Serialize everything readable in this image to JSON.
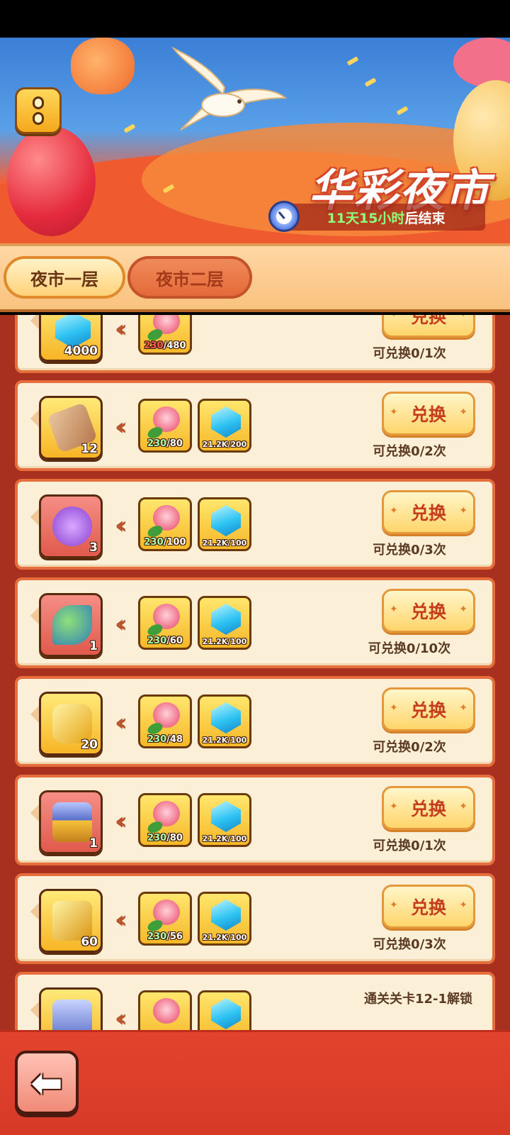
{
  "event": {
    "title": "华彩夜市",
    "timer_prefix": "11天15小时",
    "timer_suffix": "后结束"
  },
  "tabs": [
    {
      "label": "夜市一层",
      "active": true
    },
    {
      "label": "夜市二层",
      "active": false
    }
  ],
  "exchange_label": "兑换",
  "items": [
    {
      "reward_icon": "gem-icon",
      "reward_qty": "4000",
      "slot_color": "gold",
      "flower_have": "230",
      "flower_need": "/480",
      "flower_short": true,
      "gem_cost": "",
      "limit": "可兑换0/1次"
    },
    {
      "reward_icon": "scroll-icon",
      "reward_qty": "12",
      "slot_color": "gold",
      "flower_have": "230",
      "flower_need": "/80",
      "flower_short": false,
      "gem_cost": "21.2K/200",
      "limit": "可兑换0/2次"
    },
    {
      "reward_icon": "magic-scroll-icon",
      "reward_qty": "3",
      "slot_color": "red",
      "flower_have": "230",
      "flower_need": "/100",
      "flower_short": false,
      "gem_cost": "21.2K/100",
      "limit": "可兑换0/3次"
    },
    {
      "reward_icon": "bean-pod-icon",
      "reward_qty": "1",
      "slot_color": "red",
      "flower_have": "230",
      "flower_need": "/60",
      "flower_short": false,
      "gem_cost": "21.2K/100",
      "limit": "可兑换0/10次"
    },
    {
      "reward_icon": "gold-puzzle-icon",
      "reward_qty": "20",
      "slot_color": "gold",
      "flower_have": "230",
      "flower_need": "/48",
      "flower_short": false,
      "gem_cost": "21.2K/100",
      "limit": "可兑换0/2次"
    },
    {
      "reward_icon": "treasure-chest-icon",
      "reward_qty": "1",
      "slot_color": "red",
      "flower_have": "230",
      "flower_need": "/80",
      "flower_short": false,
      "gem_cost": "21.2K/100",
      "limit": "可兑换0/1次"
    },
    {
      "reward_icon": "gold-block-icon",
      "reward_qty": "60",
      "slot_color": "gold",
      "flower_have": "230",
      "flower_need": "/56",
      "flower_short": false,
      "gem_cost": "21.2K/100",
      "limit": "可兑换0/3次"
    }
  ],
  "partial_row_text": "通关关卡12-1解锁",
  "colors": {
    "accent": "#e56e3c",
    "button_text": "#c43d1c",
    "have_green": "#a8ffb4",
    "short_red": "#ff5a5a"
  }
}
